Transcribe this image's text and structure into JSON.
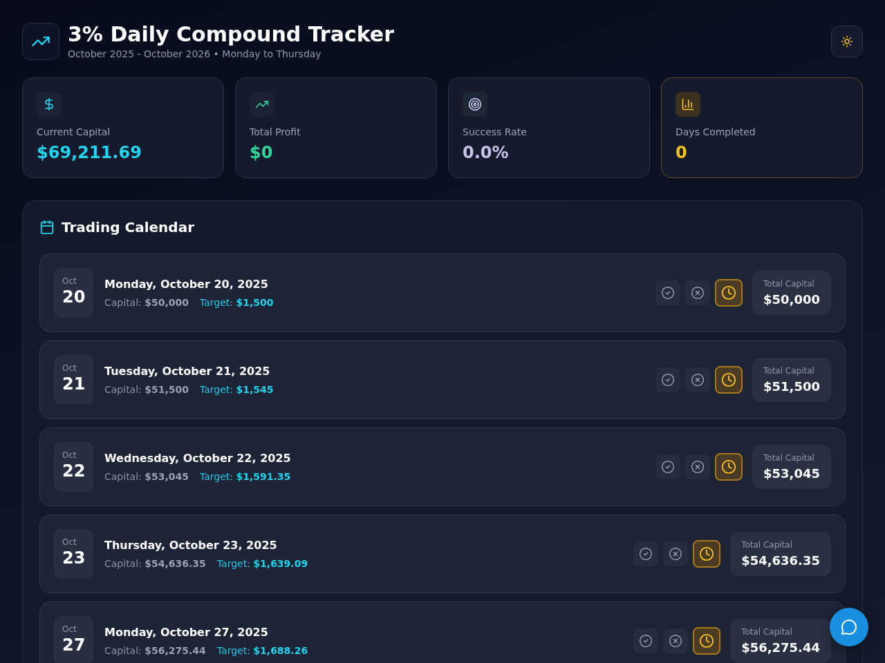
{
  "header": {
    "title": "3% Daily Compound Tracker",
    "subtitle": "October 2025 - October 2026 • Monday to Thursday"
  },
  "stats": [
    {
      "kind": "capital",
      "label": "Current Capital",
      "value": "$69,211.69",
      "color": "#22d3ee",
      "highlighted": false
    },
    {
      "kind": "profit",
      "label": "Total Profit",
      "value": "$0",
      "color": "#34d399",
      "highlighted": false
    },
    {
      "kind": "rate",
      "label": "Success Rate",
      "value": "0.0%",
      "color": "#c7c3ea",
      "highlighted": false
    },
    {
      "kind": "days",
      "label": "Days Completed",
      "value": "0",
      "color": "#fbbf24",
      "highlighted": true
    }
  ],
  "calendar": {
    "title": "Trading Calendar",
    "days": [
      {
        "month": "Oct",
        "day": "20",
        "date": "Monday, October 20, 2025",
        "capital": "Capital: **$50,000**",
        "target": "Target: **$1,500**",
        "actions": [
          {
            "kind": "won",
            "selected": false
          },
          {
            "kind": "lost",
            "selected": false
          },
          {
            "kind": "pending",
            "selected": true
          }
        ],
        "total_label": "Total Capital",
        "total": "$50,000"
      },
      {
        "month": "Oct",
        "day": "21",
        "date": "Tuesday, October 21, 2025",
        "capital": "Capital: **$51,500**",
        "target": "Target: **$1,545**",
        "actions": [
          {
            "kind": "won",
            "selected": false
          },
          {
            "kind": "lost",
            "selected": false
          },
          {
            "kind": "pending",
            "selected": true
          }
        ],
        "total_label": "Total Capital",
        "total": "$51,500"
      },
      {
        "month": "Oct",
        "day": "22",
        "date": "Wednesday, October 22, 2025",
        "capital": "Capital: **$53,045**",
        "target": "Target: **$1,591.35**",
        "actions": [
          {
            "kind": "won",
            "selected": false
          },
          {
            "kind": "lost",
            "selected": false
          },
          {
            "kind": "pending",
            "selected": true
          }
        ],
        "total_label": "Total Capital",
        "total": "$53,045"
      },
      {
        "month": "Oct",
        "day": "23",
        "date": "Thursday, October 23, 2025",
        "capital": "Capital: **$54,636.35**",
        "target": "Target: **$1,639.09**",
        "actions": [
          {
            "kind": "won",
            "selected": false
          },
          {
            "kind": "lost",
            "selected": false
          },
          {
            "kind": "pending",
            "selected": true
          }
        ],
        "total_label": "Total Capital",
        "total": "$54,636.35"
      },
      {
        "month": "Oct",
        "day": "27",
        "date": "Monday, October 27, 2025",
        "capital": "Capital: **$56,275.44**",
        "target": "Target: **$1,688.26**",
        "actions": [
          {
            "kind": "won",
            "selected": false
          },
          {
            "kind": "lost",
            "selected": false
          },
          {
            "kind": "pending",
            "selected": true
          }
        ],
        "total_label": "Total Capital",
        "total": "$56,275.44"
      }
    ]
  }
}
